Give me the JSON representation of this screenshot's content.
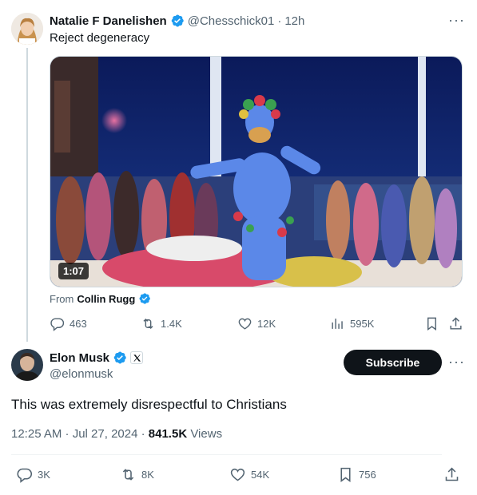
{
  "quoted": {
    "author_name": "Natalie F Danelishen",
    "handle": "@Chesschick01",
    "separator": "·",
    "time": "12h",
    "text": "Reject degeneracy",
    "video_duration": "1:07",
    "from_label": "From",
    "from_author": "Collin Rugg",
    "stats": {
      "replies": "463",
      "reposts": "1.4K",
      "likes": "12K",
      "views": "595K"
    }
  },
  "post": {
    "author_name": "Elon Musk",
    "handle": "@elonmusk",
    "subscribe_label": "Subscribe",
    "text": "This was extremely disrespectful to Christians",
    "timestamp": "12:25 AM · Jul 27, 2024 · ",
    "views_count": "841.5K",
    "views_label": " Views",
    "stats": {
      "replies": "3K",
      "reposts": "8K",
      "likes": "54K",
      "bookmarks": "756"
    }
  },
  "colors": {
    "verified_blue": "#1d9bf0",
    "muted": "#536471",
    "text": "#0f1419"
  }
}
